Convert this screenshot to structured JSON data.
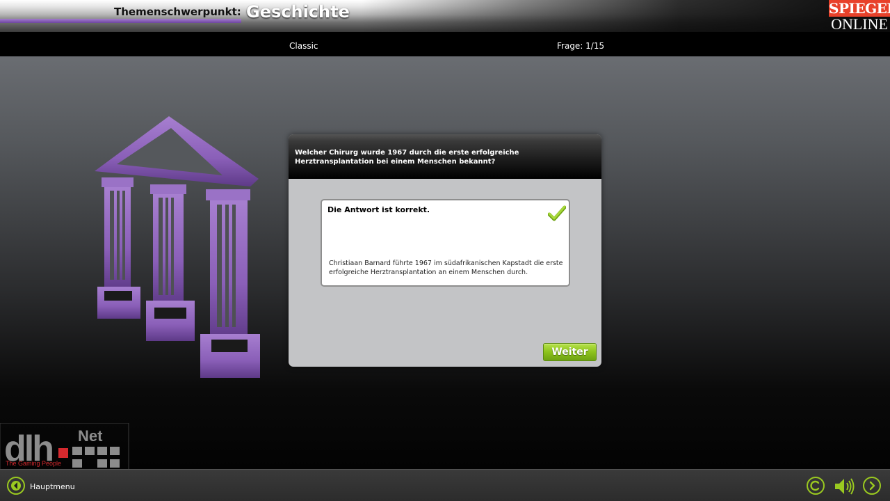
{
  "header": {
    "theme_label": "Themenschwerpunkt:",
    "theme_value": "Geschichte",
    "logo_top": "SPIEGEL",
    "logo_bottom": "ONLINE"
  },
  "info_bar": {
    "mode": "Classic",
    "progress": "Frage: 1/15"
  },
  "question": {
    "text": "Welcher Chirurg wurde 1967 durch die erste erfolgreiche Herztransplantation bei einem Menschen bekannt?"
  },
  "result": {
    "title": "Die Antwort ist korrekt.",
    "explanation": "Christiaan Barnard führte 1967 im südafrikanischen Kapstadt die erste erfolgreiche Herztransplantation an einem Menschen durch.",
    "icon": "checkmark-icon"
  },
  "buttons": {
    "next": "Weiter"
  },
  "publisher": {
    "brand": "dlh",
    "brand_suffix": "Net",
    "tagline": "The Gaming People"
  },
  "footer": {
    "menu_label": "Hauptmenu",
    "icons": [
      "back-arrow-icon",
      "copyright-icon",
      "speaker-icon",
      "forward-arrow-icon"
    ]
  },
  "colors": {
    "accent_purple": "#8a5fb8",
    "accent_green": "#9ac920",
    "spiegel_red": "#e8412a"
  }
}
